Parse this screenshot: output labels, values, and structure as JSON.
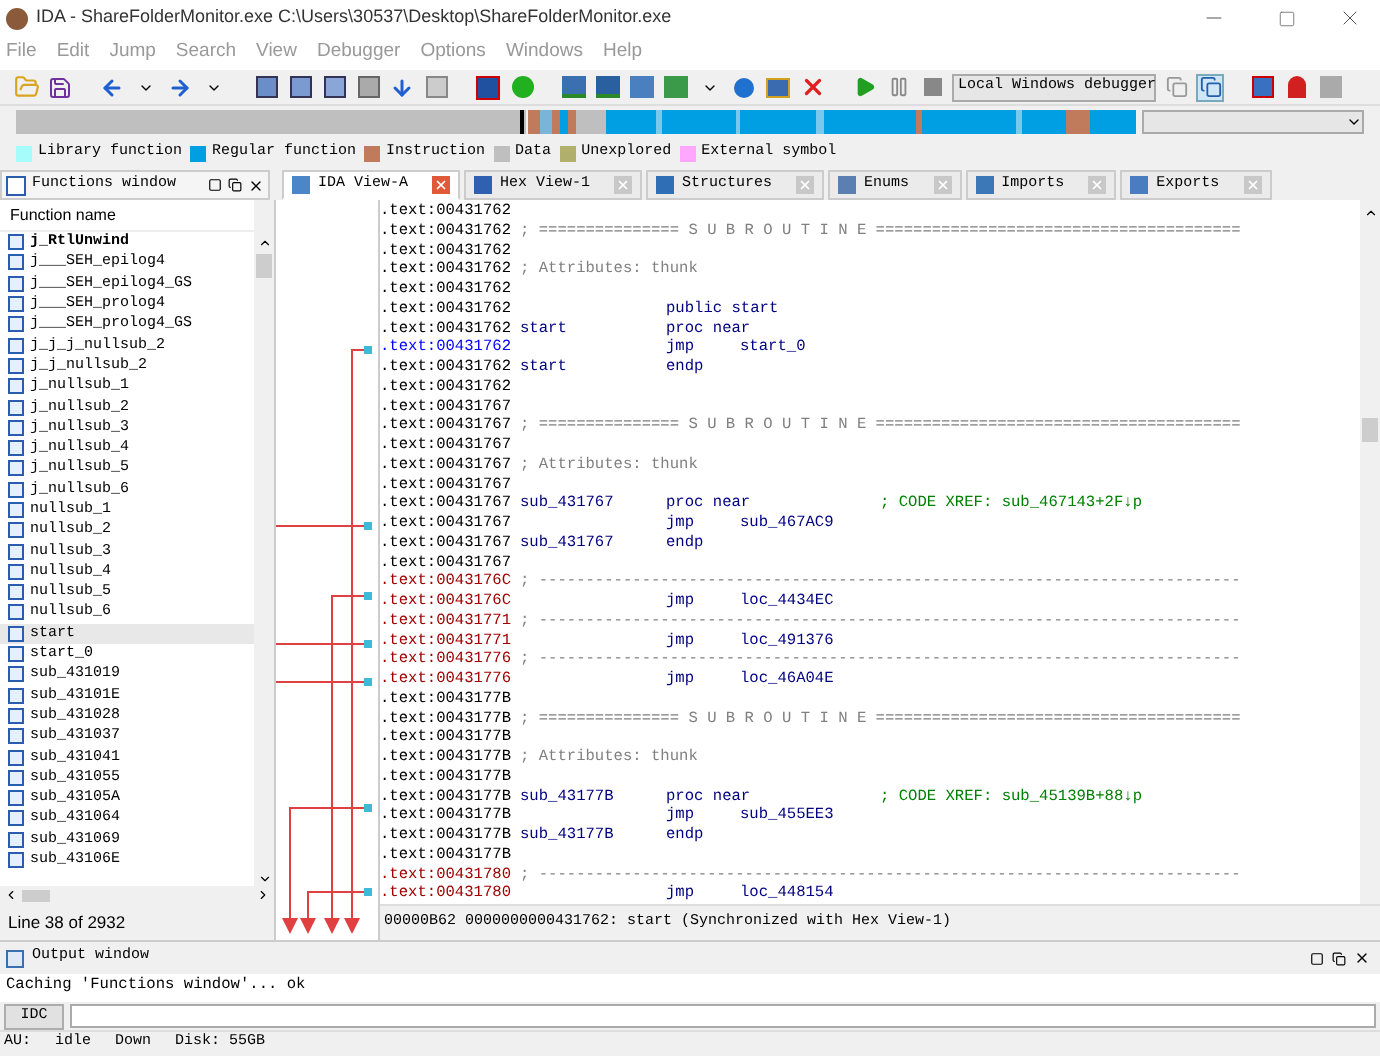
{
  "window": {
    "title": "IDA - ShareFolderMonitor.exe C:\\Users\\30537\\Desktop\\ShareFolderMonitor.exe"
  },
  "menu": [
    "File",
    "Edit",
    "Jump",
    "Search",
    "View",
    "Debugger",
    "Options",
    "Windows",
    "Help"
  ],
  "toolbar": {
    "debugger": "Local Windows debugger"
  },
  "legend": [
    {
      "label": "Library function",
      "color": "#a6fbfb"
    },
    {
      "label": "Regular function",
      "color": "#009fe3"
    },
    {
      "label": "Instruction",
      "color": "#c07a5c"
    },
    {
      "label": "Data",
      "color": "#bfbfbf"
    },
    {
      "label": "Unexplored",
      "color": "#b0b06c"
    },
    {
      "label": "External symbol",
      "color": "#ffa6ff"
    }
  ],
  "functions_window": {
    "title": "Functions window",
    "column": "Function name",
    "status": "Line 38 of 2932",
    "items": [
      {
        "name": "j_RtlUnwind",
        "bold": true,
        "selected": false
      },
      {
        "name": "j___SEH_epilog4",
        "bold": false,
        "selected": false
      },
      {
        "name": "j___SEH_epilog4_GS",
        "bold": false,
        "selected": false
      },
      {
        "name": "j___SEH_prolog4",
        "bold": false,
        "selected": false
      },
      {
        "name": "j___SEH_prolog4_GS",
        "bold": false,
        "selected": false
      },
      {
        "name": "j_j_j_nullsub_2",
        "bold": false,
        "selected": false
      },
      {
        "name": "j_j_nullsub_2",
        "bold": false,
        "selected": false
      },
      {
        "name": "j_nullsub_1",
        "bold": false,
        "selected": false
      },
      {
        "name": "j_nullsub_2",
        "bold": false,
        "selected": false
      },
      {
        "name": "j_nullsub_3",
        "bold": false,
        "selected": false
      },
      {
        "name": "j_nullsub_4",
        "bold": false,
        "selected": false
      },
      {
        "name": "j_nullsub_5",
        "bold": false,
        "selected": false
      },
      {
        "name": "j_nullsub_6",
        "bold": false,
        "selected": false
      },
      {
        "name": "nullsub_1",
        "bold": false,
        "selected": false
      },
      {
        "name": "nullsub_2",
        "bold": false,
        "selected": false
      },
      {
        "name": "nullsub_3",
        "bold": false,
        "selected": false
      },
      {
        "name": "nullsub_4",
        "bold": false,
        "selected": false
      },
      {
        "name": "nullsub_5",
        "bold": false,
        "selected": false
      },
      {
        "name": "nullsub_6",
        "bold": false,
        "selected": false
      },
      {
        "name": "start",
        "bold": false,
        "selected": true
      },
      {
        "name": "start_0",
        "bold": false,
        "selected": false
      },
      {
        "name": "sub_431019",
        "bold": false,
        "selected": false
      },
      {
        "name": "sub_43101E",
        "bold": false,
        "selected": false
      },
      {
        "name": "sub_431028",
        "bold": false,
        "selected": false
      },
      {
        "name": "sub_431037",
        "bold": false,
        "selected": false
      },
      {
        "name": "sub_431041",
        "bold": false,
        "selected": false
      },
      {
        "name": "sub_431055",
        "bold": false,
        "selected": false
      },
      {
        "name": "sub_43105A",
        "bold": false,
        "selected": false
      },
      {
        "name": "sub_431064",
        "bold": false,
        "selected": false
      },
      {
        "name": "sub_431069",
        "bold": false,
        "selected": false
      },
      {
        "name": "sub_43106E",
        "bold": false,
        "selected": false
      }
    ]
  },
  "tabs": [
    {
      "label": "IDA View-A",
      "kind": "disasm",
      "selected": true
    },
    {
      "label": "Hex View-1",
      "kind": "hex",
      "selected": false
    },
    {
      "label": "Structures",
      "kind": "struct",
      "selected": false
    },
    {
      "label": "Enums",
      "kind": "enum",
      "selected": false
    },
    {
      "label": "Imports",
      "kind": "imports",
      "selected": false
    },
    {
      "label": "Exports",
      "kind": "exports",
      "selected": false
    }
  ],
  "code": {
    "status": "00000B62 0000000000431762: start (Synchronized with Hex View-1)",
    "lines": [
      {
        "addr": ".text:00431762",
        "kind": "plain"
      },
      {
        "addr": ".text:00431762",
        "kind": "plain",
        "comment": "; =============== S U B R O U T I N E ======================================="
      },
      {
        "addr": ".text:00431762",
        "kind": "plain"
      },
      {
        "addr": ".text:00431762",
        "kind": "plain",
        "comment": "; Attributes: thunk"
      },
      {
        "addr": ".text:00431762",
        "kind": "plain"
      },
      {
        "addr": ".text:00431762",
        "kind": "plain",
        "op": "public start"
      },
      {
        "addr": ".text:00431762",
        "kind": "plain",
        "label": "start",
        "op": "proc near"
      },
      {
        "addr": ".text:00431762",
        "kind": "cursor",
        "op": "jmp",
        "arg": "start_0"
      },
      {
        "addr": ".text:00431762",
        "kind": "plain",
        "label": "start",
        "op": "endp"
      },
      {
        "addr": ".text:00431762",
        "kind": "plain"
      },
      {
        "addr": ".text:00431767",
        "kind": "plain"
      },
      {
        "addr": ".text:00431767",
        "kind": "plain",
        "comment": "; =============== S U B R O U T I N E ======================================="
      },
      {
        "addr": ".text:00431767",
        "kind": "plain"
      },
      {
        "addr": ".text:00431767",
        "kind": "plain",
        "comment": "; Attributes: thunk"
      },
      {
        "addr": ".text:00431767",
        "kind": "plain"
      },
      {
        "addr": ".text:00431767",
        "kind": "plain",
        "label": "sub_431767",
        "op": "proc near",
        "xref": "; CODE XREF: sub_467143+2F↓p"
      },
      {
        "addr": ".text:00431767",
        "kind": "plain",
        "op": "jmp",
        "arg": "sub_467AC9"
      },
      {
        "addr": ".text:00431767",
        "kind": "plain",
        "label": "sub_431767",
        "op": "endp"
      },
      {
        "addr": ".text:00431767",
        "kind": "plain"
      },
      {
        "addr": ".text:0043176C",
        "kind": "orphan",
        "comment": "; ---------------------------------------------------------------------------"
      },
      {
        "addr": ".text:0043176C",
        "kind": "orphan",
        "op": "jmp",
        "arg": "loc_4434EC"
      },
      {
        "addr": ".text:00431771",
        "kind": "orphan",
        "comment": "; ---------------------------------------------------------------------------"
      },
      {
        "addr": ".text:00431771",
        "kind": "orphan",
        "op": "jmp",
        "arg": "loc_491376"
      },
      {
        "addr": ".text:00431776",
        "kind": "orphan",
        "comment": "; ---------------------------------------------------------------------------"
      },
      {
        "addr": ".text:00431776",
        "kind": "orphan",
        "op": "jmp",
        "arg": "loc_46A04E"
      },
      {
        "addr": ".text:0043177B",
        "kind": "plain"
      },
      {
        "addr": ".text:0043177B",
        "kind": "plain",
        "comment": "; =============== S U B R O U T I N E ======================================="
      },
      {
        "addr": ".text:0043177B",
        "kind": "plain"
      },
      {
        "addr": ".text:0043177B",
        "kind": "plain",
        "comment": "; Attributes: thunk"
      },
      {
        "addr": ".text:0043177B",
        "kind": "plain"
      },
      {
        "addr": ".text:0043177B",
        "kind": "plain",
        "label": "sub_43177B",
        "op": "proc near",
        "xref": "; CODE XREF: sub_45139B+88↓p"
      },
      {
        "addr": ".text:0043177B",
        "kind": "plain",
        "op": "jmp",
        "arg": "sub_455EE3"
      },
      {
        "addr": ".text:0043177B",
        "kind": "plain",
        "label": "sub_43177B",
        "op": "endp"
      },
      {
        "addr": ".text:0043177B",
        "kind": "plain"
      },
      {
        "addr": ".text:00431780",
        "kind": "orphan",
        "comment": "; ---------------------------------------------------------------------------"
      },
      {
        "addr": ".text:00431780",
        "kind": "orphan",
        "op": "jmp",
        "arg": "loc_448154"
      }
    ]
  },
  "output": {
    "title": "Output window",
    "lines": [
      "Caching 'Functions window'... ok"
    ],
    "command_button": "IDC"
  },
  "status_bar": [
    "AU:",
    "idle",
    "Down",
    "Disk: 55GB"
  ]
}
